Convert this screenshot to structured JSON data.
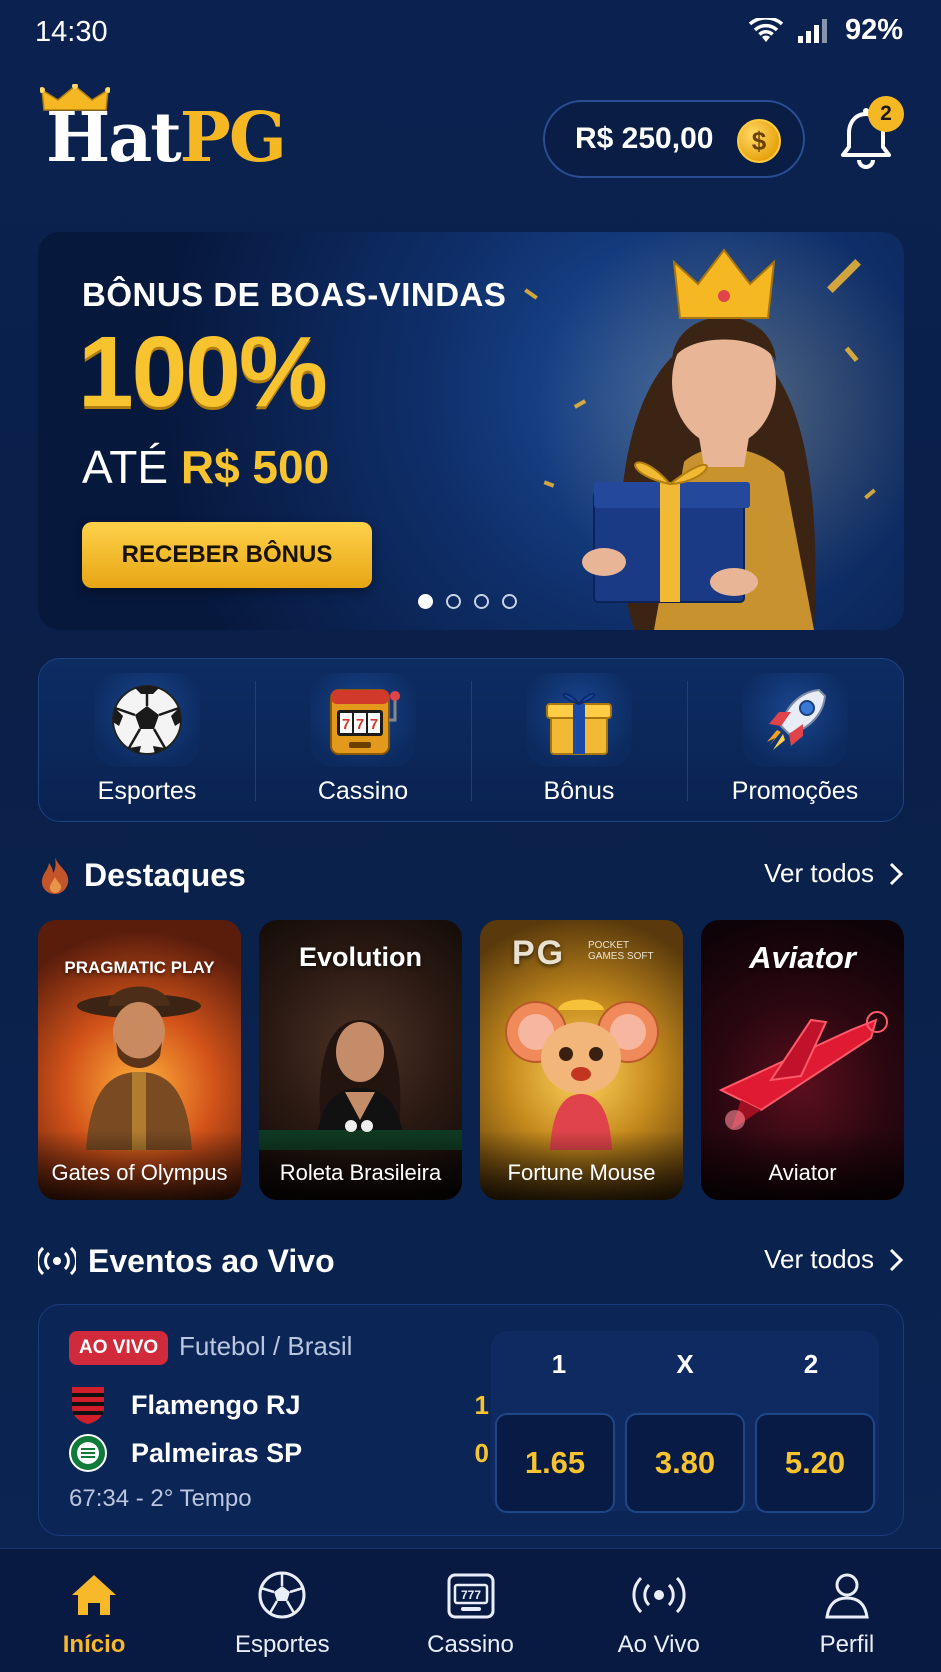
{
  "status_bar": {
    "time": "14:30",
    "battery": "92%"
  },
  "header": {
    "logo": {
      "part1": "Hat",
      "part2": "PG"
    },
    "balance": "R$ 250,00",
    "notifications_count": "2"
  },
  "banner": {
    "kicker": "BÔNUS DE BOAS-VINDAS",
    "headline": "100%",
    "line_prefix": "ATÉ",
    "line_amount": "R$ 500",
    "cta": "RECEBER BÔNUS",
    "slides_total": 4,
    "active_slide": 1
  },
  "quick_access": [
    {
      "label": "Esportes",
      "icon": "soccer-ball-icon"
    },
    {
      "label": "Cassino",
      "icon": "slot-machine-icon"
    },
    {
      "label": "Bônus",
      "icon": "gift-icon"
    },
    {
      "label": "Promoções",
      "icon": "rocket-icon"
    }
  ],
  "highlights": {
    "title": "Destaques",
    "see_all": "Ver todos",
    "games": [
      {
        "provider": "PRAGMATIC PLAY",
        "name": "Gates of Olympus"
      },
      {
        "provider": "Evolution",
        "name": "Roleta Brasileira"
      },
      {
        "provider": "PG",
        "provider_sub": "POCKET GAMES SOFT",
        "name": "Fortune Mouse"
      },
      {
        "provider": "Aviator",
        "name": "Aviator"
      }
    ]
  },
  "live": {
    "title": "Eventos ao Vivo",
    "see_all": "Ver todos",
    "event": {
      "badge": "AO VIVO",
      "league": "Futebol / Brasil",
      "home": {
        "name": "Flamengo RJ",
        "score": "1"
      },
      "away": {
        "name": "Palmeiras SP",
        "score": "0"
      },
      "time": "67:34 - 2° Tempo",
      "odds_labels": [
        "1",
        "X",
        "2"
      ],
      "odds": [
        "1.65",
        "3.80",
        "5.20"
      ]
    }
  },
  "bottom_nav": [
    {
      "label": "Início",
      "icon": "home-icon",
      "active": true
    },
    {
      "label": "Esportes",
      "icon": "soccer-ball-icon",
      "active": false
    },
    {
      "label": "Cassino",
      "icon": "slot-machine-icon",
      "active": false
    },
    {
      "label": "Ao Vivo",
      "icon": "live-broadcast-icon",
      "active": false
    },
    {
      "label": "Perfil",
      "icon": "user-icon",
      "active": false
    }
  ],
  "colors": {
    "accent": "#f7b82a",
    "background": "#0b2150",
    "live_red": "#d12a3a"
  }
}
